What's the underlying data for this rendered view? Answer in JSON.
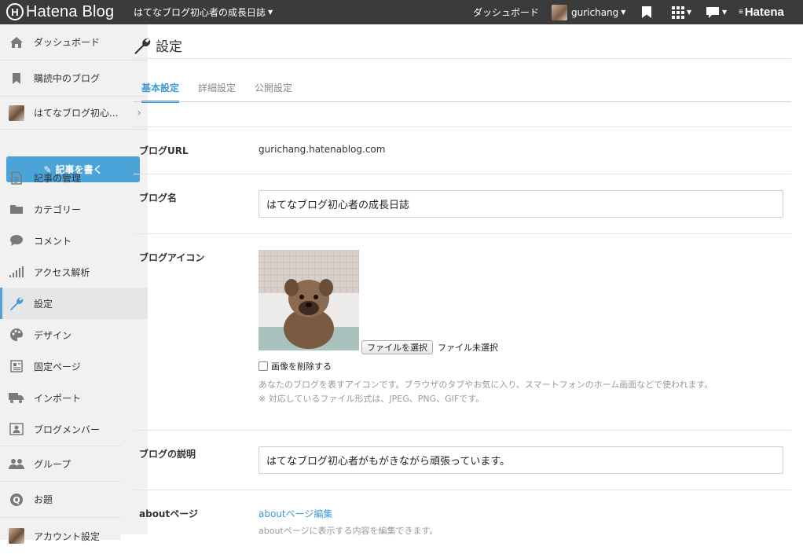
{
  "topbar": {
    "logo_text": "Hatena Blog",
    "blog_title": "はてなブログ初心者の成長日誌",
    "dashboard": "ダッシュボード",
    "username": "gurichang",
    "brand": "Hatena",
    "icons": [
      "bookmark-icon",
      "apps-grid-icon",
      "comment-icon"
    ]
  },
  "sidebar": {
    "items": [
      {
        "label": "ダッシュボード",
        "icon": "home-icon"
      },
      {
        "label": "購読中のブログ",
        "icon": "bookmark-icon"
      },
      {
        "label": "はてなブログ初心...",
        "icon": "blog-avatar"
      },
      {
        "label": "記事の管理",
        "icon": "document-icon"
      },
      {
        "label": "カテゴリー",
        "icon": "folder-icon"
      },
      {
        "label": "コメント",
        "icon": "comment-icon"
      },
      {
        "label": "アクセス解析",
        "icon": "bar-chart-icon"
      },
      {
        "label": "設定",
        "icon": "wrench-icon"
      },
      {
        "label": "デザイン",
        "icon": "palette-icon"
      },
      {
        "label": "固定ページ",
        "icon": "page-icon"
      },
      {
        "label": "インポート",
        "icon": "truck-icon"
      },
      {
        "label": "ブログメンバー",
        "icon": "member-card-icon"
      },
      {
        "label": "グループ",
        "icon": "group-icon"
      },
      {
        "label": "お題",
        "icon": "question-icon"
      },
      {
        "label": "アカウント設定",
        "icon": "user-avatar"
      }
    ],
    "write_button": "記事を書く"
  },
  "main": {
    "title": "設定",
    "tabs": [
      "基本設定",
      "詳細設定",
      "公開設定"
    ],
    "fields": {
      "url_label": "ブログURL",
      "url_value": "gurichang.hatenablog.com",
      "name_label": "ブログ名",
      "name_value": "はてなブログ初心者の成長日誌",
      "icon_label": "ブログアイコン",
      "file_button": "ファイルを選択",
      "file_status": "ファイル未選択",
      "delete_label": "画像を削除する",
      "icon_help_1": "あなたのブログを表すアイコンです。ブラウザのタブやお気に入り、スマートフォンのホーム画面などで使われます。",
      "icon_help_2": "※ 対応しているファイル形式は、JPEG、PNG、GIFです。",
      "desc_label": "ブログの説明",
      "desc_value": "はてなブログ初心者がもがきながら頑張っています。",
      "about_label": "aboutページ",
      "about_link": "aboutページ編集",
      "about_help": "aboutページに表示する内容を編集できます。"
    }
  }
}
